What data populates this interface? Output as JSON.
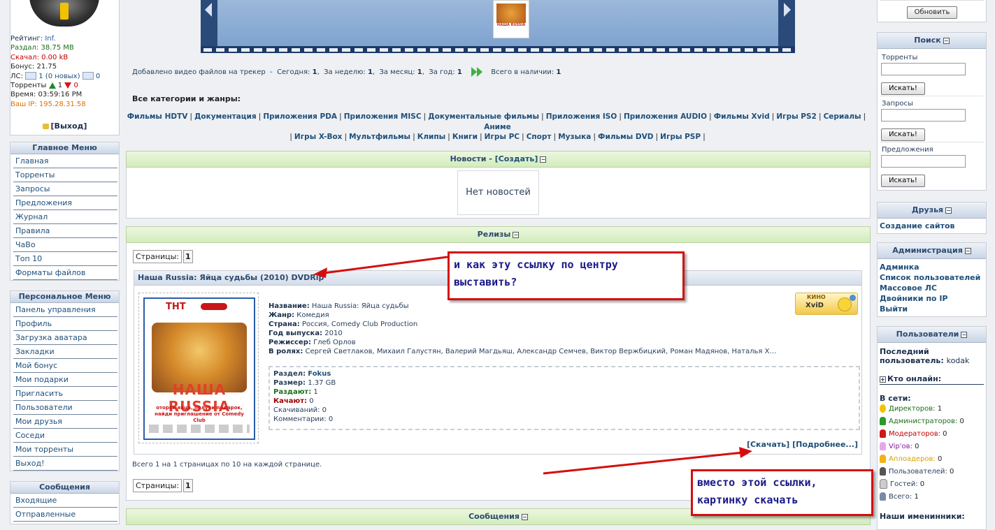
{
  "user": {
    "rating_label": "Рейтинг:",
    "rating_value": "Inf.",
    "uploaded_label": "Раздал:",
    "uploaded_value": "38.75 MB",
    "downloaded_label": "Скачал:",
    "downloaded_value": "0.00 kB",
    "bonus_label": "Бонус:",
    "bonus_value": "21.75",
    "pm_label": "ЛС:",
    "pm_value": "1 (0 новых)",
    "pm_outbox": "0",
    "torrents_label": "Торренты",
    "seeding": "1",
    "leeching": "0",
    "time_label": "Время:",
    "time_value": "03:59:16 PM",
    "ip_label": "Ваш IP:",
    "ip_value": "195.28.31.58",
    "logout": "[Выход]"
  },
  "main_menu": {
    "title": "Главное Меню",
    "items": [
      "Главная",
      "Торренты",
      "Запросы",
      "Предложения",
      "Журнал",
      "Правила",
      "ЧаВо",
      "Топ 10",
      "Форматы файлов"
    ]
  },
  "personal_menu": {
    "title": "Персональное Меню",
    "items": [
      "Панель управления",
      "Профиль",
      "Загрузка аватара",
      "Закладки",
      "Мой бонус",
      "Мои подарки",
      "Пригласить",
      "Пользователи",
      "Мои друзья",
      "Соседи",
      "Мои торренты",
      "Выход!"
    ]
  },
  "messages_menu": {
    "title": "Сообщения",
    "items": [
      "Входящие",
      "Отправленные"
    ]
  },
  "stats": {
    "added_label": "Добавлено видео файлов на трекер",
    "dash": "-",
    "today_label": "Сегодня:",
    "today": "1",
    "week_label": "За неделю:",
    "week": "1",
    "month_label": "За месяц:",
    "month": "1",
    "year_label": "За год:",
    "year": "1",
    "total_label": "Всего в наличии:",
    "total": "1"
  },
  "categories": {
    "title": "Все категории и жанры:",
    "line1": [
      "Фильмы HDTV",
      "Документация",
      "Приложения PDA",
      "Приложения MISC",
      "Документальные фильмы",
      "Приложения ISO",
      "Приложения AUDIO",
      "Фильмы Xvid",
      "Игры PS2",
      "Сериалы",
      "Аниме"
    ],
    "line2": [
      "Игры X-Box",
      "Мультфильмы",
      "Клипы",
      "Книги",
      "Игры PC",
      "Спорт",
      "Музыка",
      "Фильмы DVD",
      "Игры PSP"
    ]
  },
  "news": {
    "title": "Новости - ",
    "create": "[Создать]",
    "empty": "Нет новостей"
  },
  "releases": {
    "title": "Релизы",
    "pages_label": "Страницы:",
    "page": "1",
    "item": {
      "title": "Наша Russia: Яйца судьбы (2010) DVDRip",
      "poster_brand": "ТНТ",
      "poster_title": "НАША RUSSIA",
      "poster_sub": "оторви яйца, получи подарок, найди приглашение от Comedy Club",
      "badge_top": "КИНО",
      "badge_main": "XviD",
      "name_label": "Название:",
      "name": "Наша Russia: Яйца судьбы",
      "genre_label": "Жанр:",
      "genre": "Комедия",
      "country_label": "Страна:",
      "country": "Россия, Comedy Club Production",
      "year_label": "Год выпуска:",
      "year": "2010",
      "director_label": "Режиссер:",
      "director": "Глеб Орлов",
      "cast_label": "В ролях:",
      "cast": "Сергей Светлаков, Михаил Галустян, Валерий Магдьяш, Александр Семчев, Виктор Вержбицкий, Роман Мадянов, Наталья Хар…",
      "section_label": "Раздел:",
      "section": "Fokus",
      "size_label": "Размер:",
      "size": "1.37 GB",
      "seeders_label": "Раздают:",
      "seeders": "1",
      "leechers_label": "Качают:",
      "leechers": "0",
      "downloads_label": "Скачиваний:",
      "downloads": "0",
      "comments_label": "Комментарии:",
      "comments": "0",
      "download_link": "[Скачать]",
      "details_link": "[Подробнее...]"
    },
    "total_text": "Всего 1 на 1 страницах по 10 на каждой странице."
  },
  "bottom_panel_title": "Сообщения",
  "right": {
    "refresh_button": "Обновить",
    "search": {
      "title": "Поиск",
      "torrents_label": "Торренты",
      "requests_label": "Запросы",
      "offers_label": "Предложения",
      "button": "Искать!"
    },
    "friends": {
      "title": "Друзья",
      "link": "Создание сайтов"
    },
    "admin": {
      "title": "Администрация",
      "links": [
        "Админка",
        "Список пользователей",
        "Массовое ЛС",
        "Двойники по IP",
        "Выйти"
      ]
    },
    "users": {
      "title": "Пользователи",
      "last_label": "Последний пользователь:",
      "last_user": "kodak",
      "who_online": "Кто онлайн:",
      "online_label": "В сети:",
      "groups": [
        {
          "label": "Директоров:",
          "count": "1",
          "color": "#1a6e1a"
        },
        {
          "label": "Администраторов:",
          "count": "0",
          "color": "#1a6e1a"
        },
        {
          "label": "Модераторов:",
          "count": "0",
          "color": "#c00000"
        },
        {
          "label": "Vip'ов:",
          "count": "0",
          "color": "#8a1aa0"
        },
        {
          "label": "Аплоадеров:",
          "count": "0",
          "color": "#d9a000"
        },
        {
          "label": "Пользователей:",
          "count": "0",
          "color": "#2a3f5e"
        },
        {
          "label": "Гостей:",
          "count": "0",
          "color": "#2a3f5e"
        },
        {
          "label": "Всего:",
          "count": "1",
          "color": "#2a3f5e"
        }
      ],
      "footer": "Наши именинники:"
    }
  },
  "callouts": {
    "center_question": "и как эту ссылку по центру выставить?",
    "download_image": "вместо этой ссылки, картинку скачать"
  },
  "colors": {
    "callout_border": "#d60d0d",
    "callout_text": "#1a1a8a",
    "panel_green": "#d2ecbc",
    "menu_blue": "#c9d5e6"
  }
}
